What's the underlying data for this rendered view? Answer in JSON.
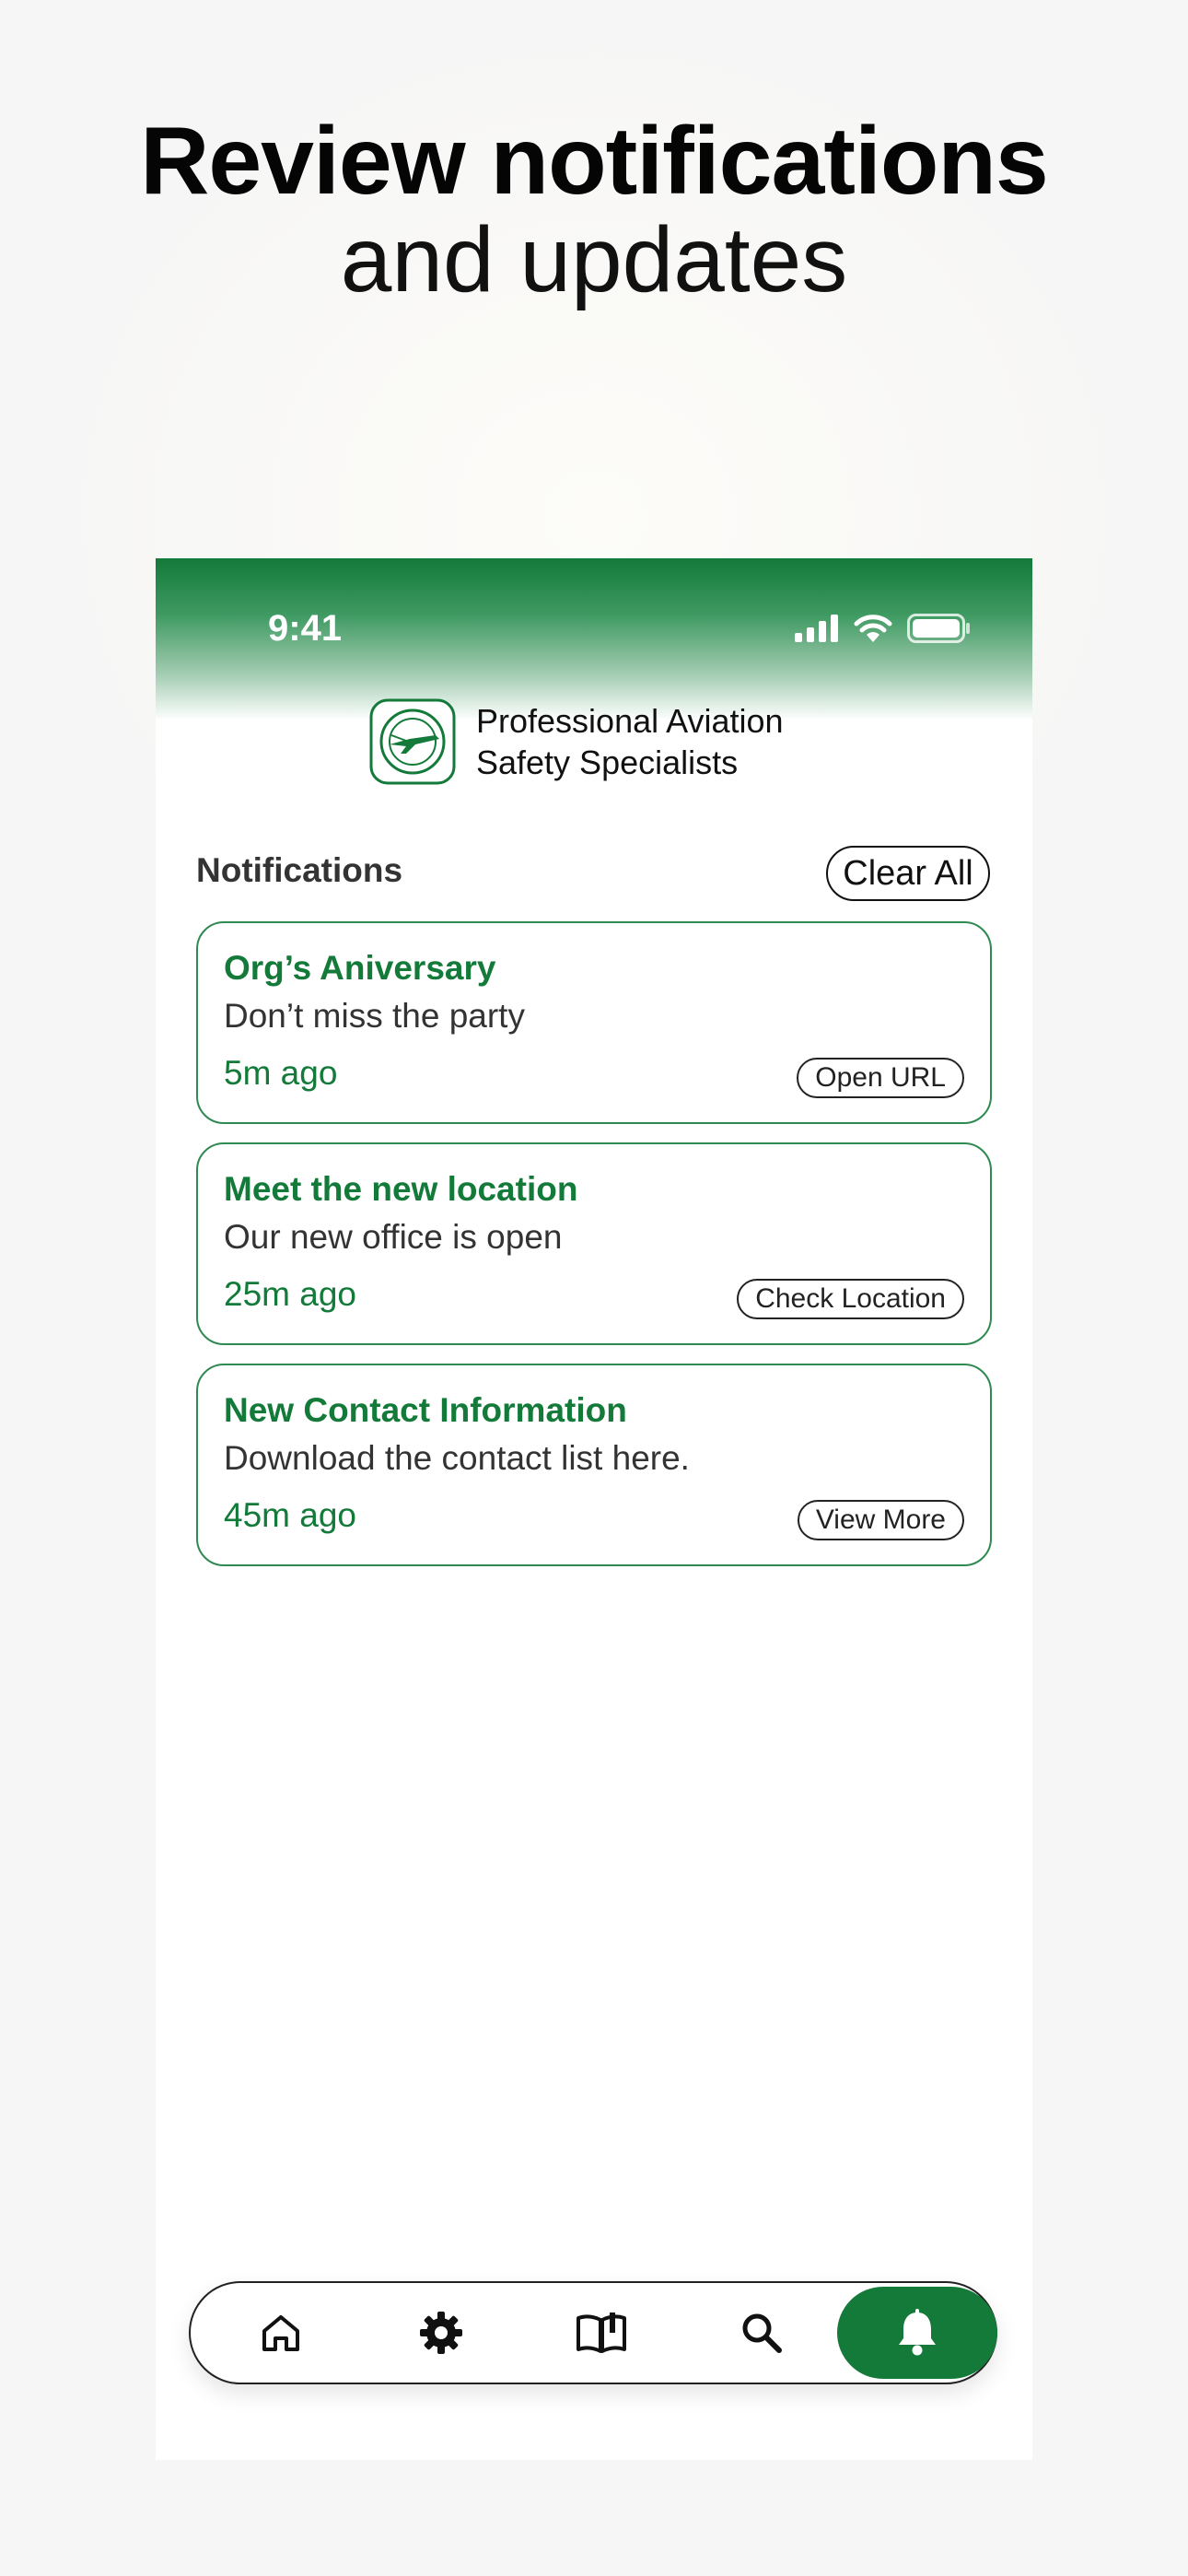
{
  "headline": {
    "bold": "Review notifications",
    "light": "and updates"
  },
  "status_bar": {
    "time": "9:41"
  },
  "brand": {
    "name_line1": "Professional Aviation",
    "name_line2": "Safety Specialists"
  },
  "notifications": {
    "title": "Notifications",
    "clear_all_label": "Clear All",
    "items": [
      {
        "title": "Org’s Aniversary",
        "body": "Don’t miss the party",
        "time": "5m ago",
        "action": "Open URL"
      },
      {
        "title": "Meet the new location",
        "body": "Our new office is open",
        "time": "25m ago",
        "action": "Check Location"
      },
      {
        "title": "New Contact Information",
        "body": "Download the contact list here.",
        "time": "45m ago",
        "action": "View More"
      }
    ]
  },
  "tab_bar": {
    "tabs": [
      {
        "icon": "home-icon"
      },
      {
        "icon": "gear-icon"
      },
      {
        "icon": "book-icon"
      },
      {
        "icon": "search-icon"
      },
      {
        "icon": "bell-icon",
        "active": true
      }
    ]
  },
  "colors": {
    "brand_green": "#137a3a",
    "card_border": "#2e8a50",
    "text_dark": "#333333"
  }
}
